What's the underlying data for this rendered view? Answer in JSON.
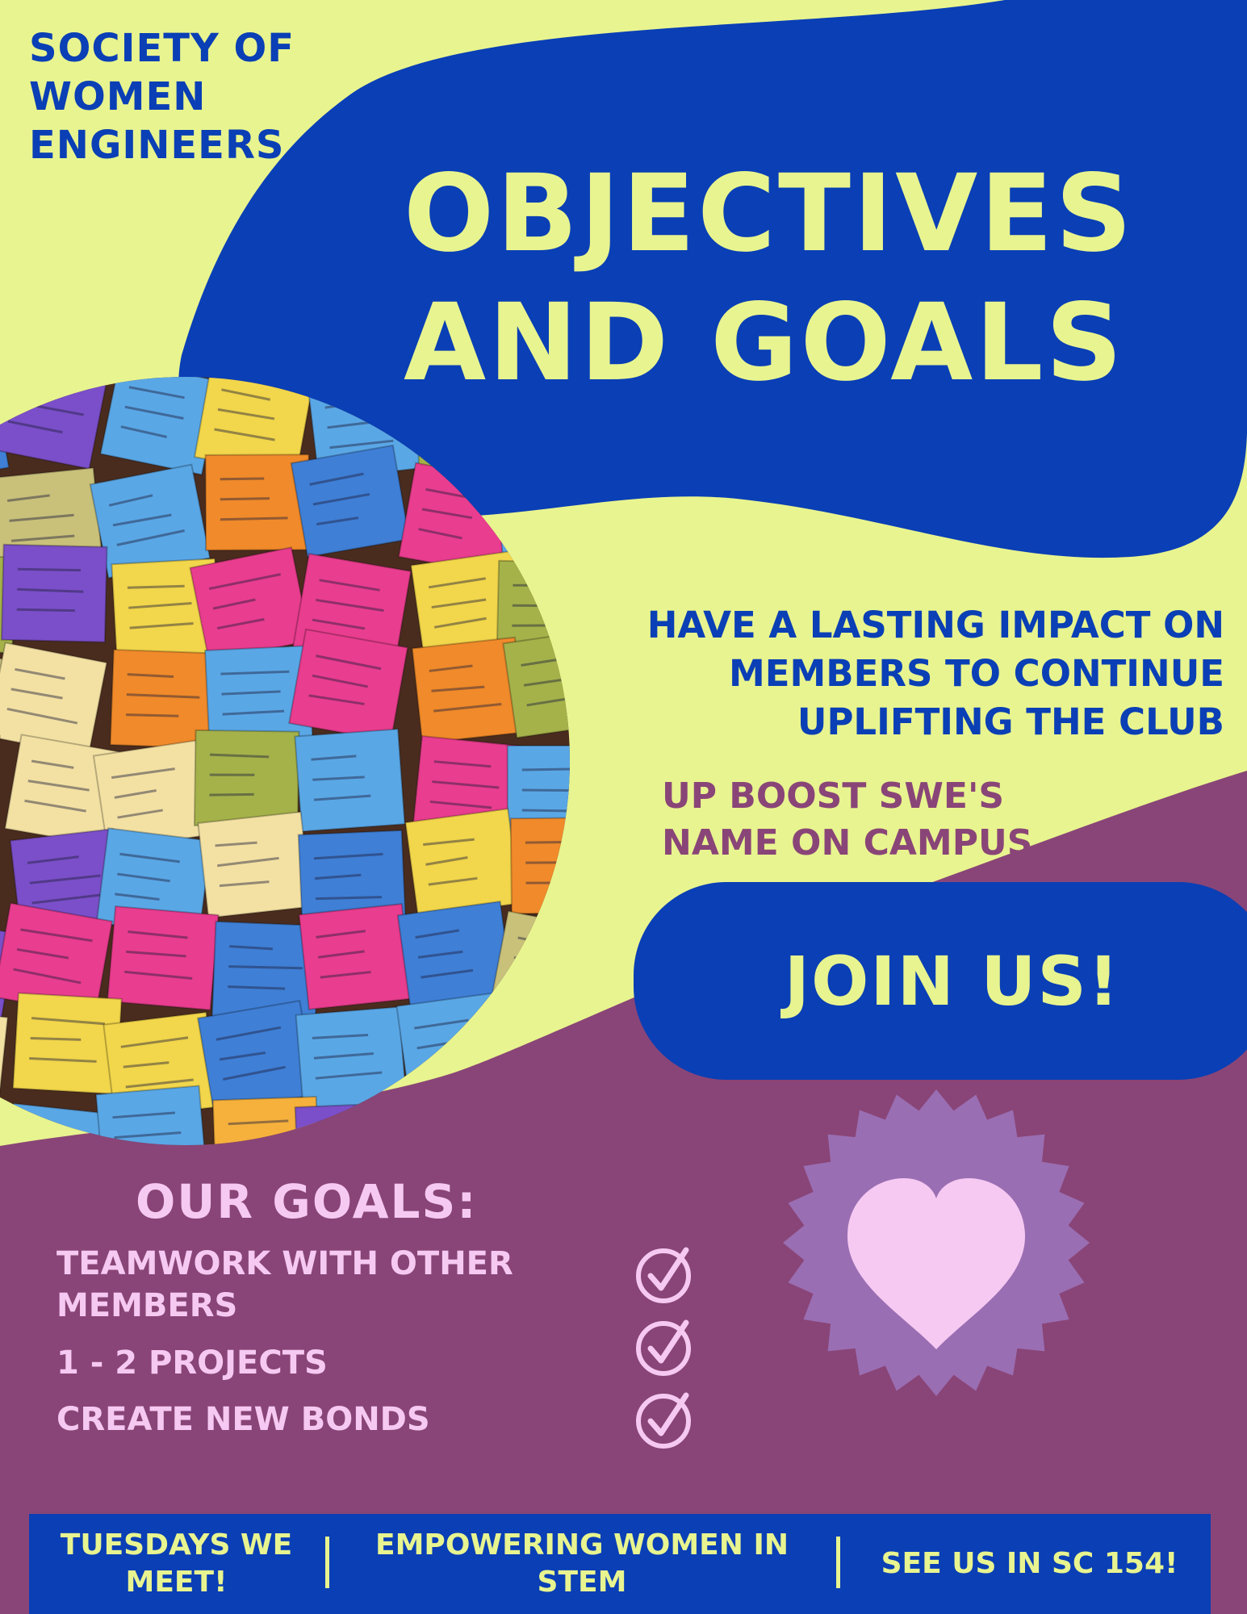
{
  "organization": {
    "name_lines": [
      "SOCIETY OF",
      "WOMEN",
      "ENGINEERS"
    ]
  },
  "headline": {
    "lines": [
      "OBJECTIVES",
      "AND GOALS"
    ]
  },
  "objectives": {
    "impact_lines": [
      "HAVE A LASTING IMPACT ON",
      "MEMBERS TO CONTINUE",
      "UPLIFTING THE CLUB"
    ],
    "boost_lines": [
      "UP BOOST SWE'S",
      "NAME ON CAMPUS"
    ]
  },
  "cta": {
    "label": "JOIN US!"
  },
  "photo": {
    "subject": "wall of colorful sticky notes with handwriting"
  },
  "goals": {
    "title": "OUR GOALS:",
    "items": [
      {
        "label": "TEAMWORK WITH OTHER MEMBERS",
        "icon": "checkmark-circle-icon"
      },
      {
        "label": "1 - 2 PROJECTS",
        "icon": "checkmark-circle-icon"
      },
      {
        "label": "CREATE NEW BONDS",
        "icon": "checkmark-circle-icon"
      }
    ]
  },
  "badge": {
    "icon": "heart-icon"
  },
  "footer": {
    "items": [
      "TUESDAYS WE MEET!",
      "EMPOWERING WOMEN IN STEM",
      "SEE US IN SC 154!"
    ]
  },
  "colors": {
    "lime": "#e8f48f",
    "blue": "#0a3fb5",
    "plum": "#894577",
    "pink": "#f6c9f2",
    "lavender": "#9a6eb3"
  }
}
